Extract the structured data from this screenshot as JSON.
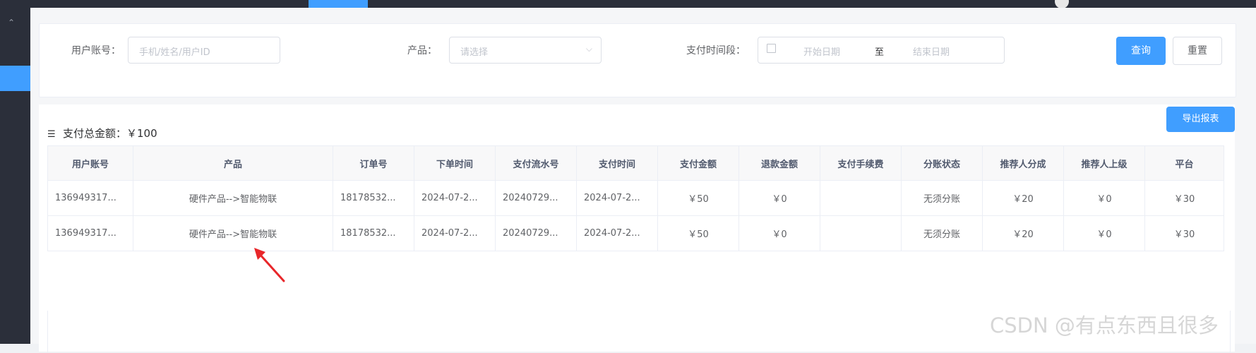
{
  "search": {
    "user_label": "用户账号：",
    "user_placeholder": "手机/姓名/用户ID",
    "product_label": "产品：",
    "product_placeholder": "请选择",
    "time_label": "支付时间段：",
    "start_placeholder": "开始日期",
    "range_sep": "至",
    "end_placeholder": "结束日期",
    "query_label": "查询",
    "reset_label": "重置"
  },
  "summary": {
    "total_label": "支付总金额：￥100",
    "export_label": "导出报表"
  },
  "table": {
    "headers": [
      "用户账号",
      "产品",
      "订单号",
      "下单时间",
      "支付流水号",
      "支付时间",
      "支付金额",
      "退款金额",
      "支付手续费",
      "分账状态",
      "推荐人分成",
      "推荐人上级",
      "平台"
    ],
    "rows": [
      [
        "136949317...",
        "硬件产品-->智能物联",
        "18178532...",
        "2024-07-2...",
        "20240729...",
        "2024-07-2...",
        "￥50",
        "￥0",
        "",
        "无须分账",
        "￥20",
        "￥0",
        "￥30"
      ],
      [
        "136949317...",
        "硬件产品-->智能物联",
        "18178532...",
        "2024-07-2...",
        "20240729...",
        "2024-07-2...",
        "￥50",
        "￥0",
        "",
        "无须分账",
        "￥20",
        "￥0",
        "￥30"
      ]
    ]
  },
  "watermark": "CSDN @有点东西且很多",
  "colors": {
    "primary": "#409eff",
    "sidebar": "#2b2f3a",
    "annotation": "#e8262a"
  }
}
